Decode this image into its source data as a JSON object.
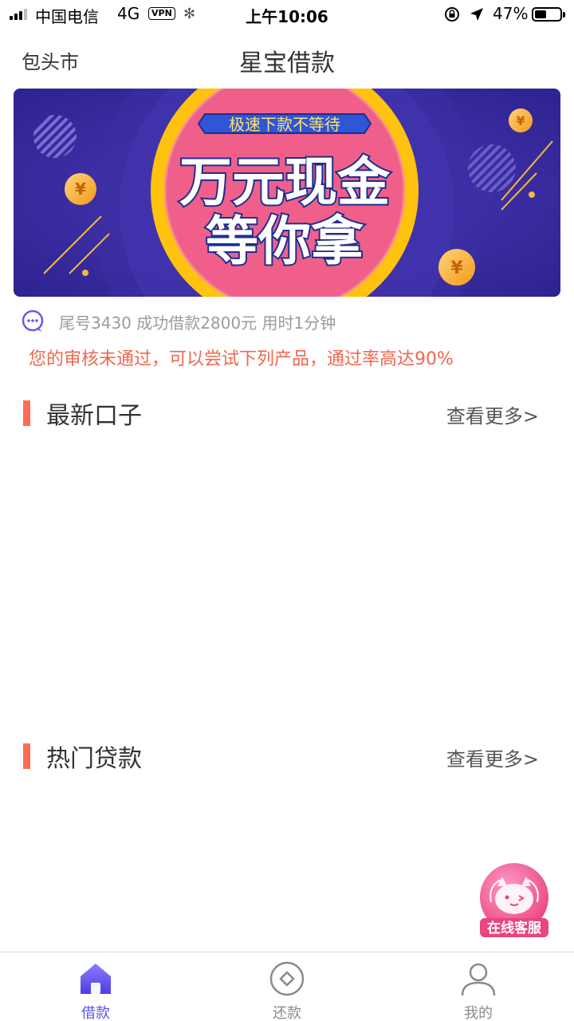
{
  "status_bar": {
    "carrier": "中国电信",
    "network": "4G",
    "vpn": "VPN",
    "time": "上午10:06",
    "battery": "47%",
    "battery_level": 0.47
  },
  "header": {
    "city": "包头市",
    "title": "星宝借款"
  },
  "banner": {
    "tagline": "极速下款不等待",
    "headline_1": "万元现金",
    "headline_2": "等你拿",
    "coin_symbol": "¥"
  },
  "notice": {
    "text": "尾号3430 成功借款2800元 用时1分钟"
  },
  "alert": {
    "text": "您的审核未通过，可以尝试下列产品，通过率高达90%"
  },
  "sections": {
    "latest": {
      "title": "最新口子",
      "more": "查看更多>"
    },
    "hot": {
      "title": "热门贷款",
      "more": "查看更多>"
    }
  },
  "service": {
    "label": "在线客服"
  },
  "tabs": [
    {
      "label": "借款",
      "icon": "home-icon",
      "active": true
    },
    {
      "label": "还款",
      "icon": "repay-icon",
      "active": false
    },
    {
      "label": "我的",
      "icon": "user-icon",
      "active": false
    }
  ],
  "colors": {
    "accent": "#5b52e8",
    "section_bar": "#ff6b52",
    "alert": "#f0674f",
    "banner_bg": "#3a2a9a"
  }
}
